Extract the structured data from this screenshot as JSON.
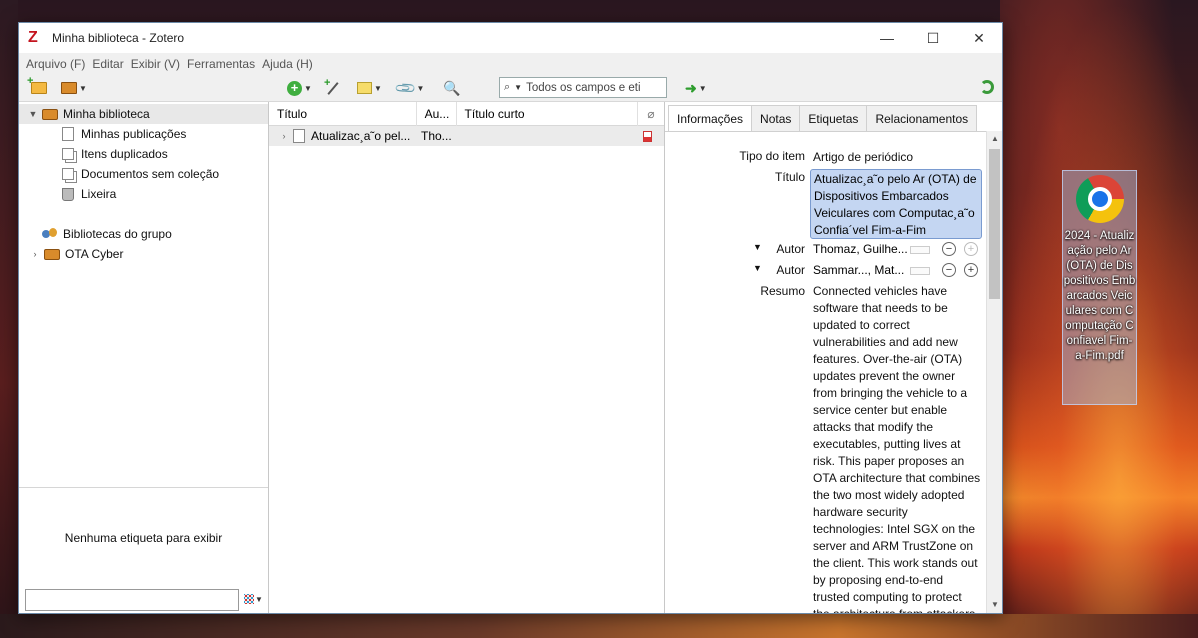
{
  "window": {
    "title": "Minha biblioteca - Zotero",
    "controls": {
      "minimize": "—",
      "maximize": "☐",
      "close": "✕"
    }
  },
  "menu": [
    "Arquivo (F)",
    "Editar",
    "Exibir (V)",
    "Ferramentas",
    "Ajuda (H)"
  ],
  "search": {
    "placeholder": "Todos os campos e eti"
  },
  "sidebar": {
    "root": "Minha biblioteca",
    "items": [
      "Minhas publicações",
      "Itens duplicados",
      "Documentos sem coleção",
      "Lixeira"
    ],
    "groups_header": "Bibliotecas do grupo",
    "groups": [
      "OTA Cyber"
    ],
    "tag_empty": "Nenhuma etiqueta para exibir"
  },
  "items_table": {
    "columns": [
      "Título",
      "Au...",
      "Título curto"
    ],
    "rows": [
      {
        "title": "Atualizac¸a˜o pel...",
        "author": "Tho...",
        "short_title": ""
      }
    ]
  },
  "tabs": [
    "Informações",
    "Notas",
    "Etiquetas",
    "Relacionamentos"
  ],
  "info": {
    "type_label": "Tipo do item",
    "type_value": "Artigo de periódico",
    "title_label": "Título",
    "title_value": "Atualizac¸a˜o pelo Ar (OTA) de Dispositivos Embarcados Veiculares com Computac¸a˜o Confia´vel Fim-a-Fim",
    "creators": [
      {
        "label": "Autor",
        "name": "Thomaz, Guilhe..."
      },
      {
        "label": "Autor",
        "name": "Sammar..., Mat..."
      }
    ],
    "abstract_label": "Resumo",
    "abstract_value": "Connected vehicles have software that needs to be updated to correct vulnerabilities and add new features. Over-the-air (OTA) updates prevent the owner from bringing the vehicle to a service center but enable attacks that modify the executables, putting lives at risk. This paper proposes an OTA architecture that combines the two most widely adopted hardware security technologies: Intel SGX on the server and ARM TrustZone on the client. This work stands out by proposing end-to-end trusted computing to protect the architecture from attackers"
  },
  "desktop_icon": {
    "label": "2024 - Atualização pelo Ar (OTA) de Dispositivos Embarcados Veiculares com Computação Confiavel Fim-a-Fim.pdf"
  },
  "colors": {
    "selection": "#c4d6f2",
    "zotero_red": "#c4141e",
    "accent_green": "#3fae3f"
  }
}
